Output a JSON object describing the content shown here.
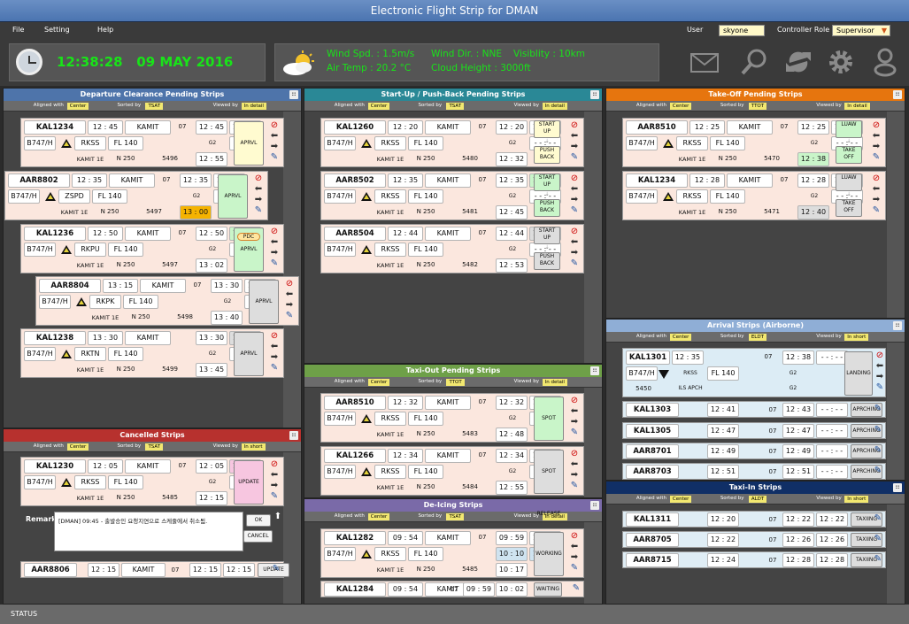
{
  "app": {
    "title": "Electronic Flight Strip for DMAN",
    "status": "STATUS"
  },
  "menu": {
    "file": "File",
    "setting": "Setting",
    "help": "Help",
    "user_label": "User",
    "user_value": "skyone",
    "role_label": "Controller Role",
    "role_value": "Supervisor"
  },
  "clock": {
    "time": "12:38:28",
    "date": "09 MAY 2016"
  },
  "weather": {
    "wind_speed": "Wind Spd. : 1.5m/s",
    "wind_dir": "Wind Dir. : NNE",
    "visibility": "Visiblity : 10km",
    "air_temp": "Air Temp : 20.2 °C",
    "cloud": "Cloud Height : 3000ft"
  },
  "icons": [
    "mail-icon",
    "search-icon",
    "refresh-icon",
    "gear-icon",
    "user-icon"
  ],
  "colors": {
    "departure": "#4e74aa",
    "startup": "#1f7f8f",
    "takeoff": "#e6750e",
    "arrival": "#8faed6",
    "taxiin": "#102f66",
    "cancelled": "#b7312e",
    "taxiout": "#6ea048",
    "deicing": "#7a6aa8",
    "time_green": "#19e319"
  },
  "panels": {
    "departure": {
      "title": "Departure Clearance Pending Strips",
      "aligned": "Aligned with",
      "aligned_val": "Center",
      "sorted": "Sorted by",
      "sorted_val": "TSAT",
      "viewed": "Viewed by",
      "viewed_val": "In detail"
    },
    "startup": {
      "title": "Start-Up / Push-Back Pending Strips",
      "aligned": "Aligned with",
      "aligned_val": "Center",
      "sorted": "Sorted by",
      "sorted_val": "TSAT",
      "viewed": "Viewed by",
      "viewed_val": "In detail"
    },
    "takeoff": {
      "title": "Take-Off Pending Strips",
      "aligned": "Aligned with",
      "aligned_val": "Center",
      "sorted": "Sorted by",
      "sorted_val": "TTOT",
      "viewed": "Viewed by",
      "viewed_val": "In detail"
    },
    "arrival": {
      "title": "Arrival  Strips (Airborne)",
      "aligned": "Aligned with",
      "aligned_val": "Center",
      "sorted": "Sorted by",
      "sorted_val": "ELDT",
      "viewed": "Viewed by",
      "viewed_val": "In short"
    },
    "taxiin": {
      "title": "Taxi-In Strips",
      "aligned": "Aligned with",
      "aligned_val": "Center",
      "sorted": "Sorted by",
      "sorted_val": "ALDT",
      "viewed": "Viewed by",
      "viewed_val": "In short"
    },
    "cancelled": {
      "title": "Cancelled Strips",
      "aligned": "Aligned with",
      "aligned_val": "Center",
      "sorted": "Sorted by",
      "sorted_val": "TSAT",
      "viewed": "Viewed by",
      "viewed_val": "In short"
    },
    "taxiout": {
      "title": "Taxi-Out Pending Strips",
      "aligned": "Aligned with",
      "aligned_val": "Center",
      "sorted": "Sorted by",
      "sorted_val": "TTOT",
      "viewed": "Viewed by",
      "viewed_val": "In detail"
    },
    "deicing": {
      "title": "De-Icing Strips",
      "aligned": "Aligned with",
      "aligned_val": "Center",
      "sorted": "Sorted by",
      "sorted_val": "TSAT",
      "viewed": "Viewed by",
      "viewed_val": "In detail"
    }
  },
  "strips": {
    "dep1": {
      "cs": "KAL1234",
      "t1": "12 : 45",
      "fix": "KAMIT",
      "rw": "07",
      "t2": "12 : 45",
      "t3": "12 : 45",
      "ac": "B747/H",
      "ap": "RKSS",
      "fl": "FL 140",
      "gate": "G2",
      "t4": "- - : - -",
      "sid": "KAMIT 1E",
      "n": "N 250",
      "sq": "5496",
      "t5": "12 : 55",
      "btn": "APRVL"
    },
    "dep2": {
      "cs": "AAR8802",
      "t1": "12 : 35",
      "fix": "KAMIT",
      "rw": "07",
      "t2": "12 : 35",
      "t3": "12 : 50",
      "ac": "B747/H",
      "ap": "ZSPD",
      "fl": "FL 140",
      "gate": "G2",
      "t4": "- - : - -",
      "sid": "KAMIT 1E",
      "n": "N 250",
      "sq": "5497",
      "t5": "13 : 00",
      "btn": "APRVL"
    },
    "dep3": {
      "cs": "KAL1236",
      "t1": "12 : 50",
      "fix": "KAMIT",
      "rw": "07",
      "t2": "12 : 50",
      "t3": "12 : 52",
      "ac": "B747/H",
      "ap": "RKPU",
      "fl": "FL 140",
      "gate": "G2",
      "t4": "- - : - -",
      "sid": "KAMIT 1E",
      "n": "N 250",
      "sq": "5497",
      "t5": "13 : 02",
      "btn": "APRVL",
      "pdc": "PDC"
    },
    "dep4": {
      "cs": "AAR8804",
      "t1": "13 : 15",
      "fix": "KAMIT",
      "rw": "07",
      "t2": "13 : 30",
      "t3": "13 : 30",
      "ac": "B747/H",
      "ap": "RKPK",
      "fl": "FL 140",
      "gate": "G2",
      "t4": "- - : - -",
      "sid": "KAMIT 1E",
      "n": "N 250",
      "sq": "5498",
      "t5": "13 : 40",
      "btn": "APRVL"
    },
    "dep5": {
      "cs": "KAL1238",
      "t1": "13 : 30",
      "fix": "KAMIT",
      "rw": "",
      "t2": "13 : 30",
      "t3": "13 : 35",
      "ac": "B747/H",
      "ap": "RKTN",
      "fl": "FL 140",
      "gate": "G2",
      "t4": "- - : - -",
      "sid": "KAMIT 1E",
      "n": "N 250",
      "sq": "5499",
      "t5": "13 : 45",
      "btn": "APRVL"
    },
    "su1": {
      "cs": "KAL1260",
      "t1": "12 : 20",
      "fix": "KAMIT",
      "rw": "07",
      "t2": "12 : 20",
      "t3": "12 : 22",
      "ac": "B747/H",
      "ap": "RKSS",
      "fl": "FL 140",
      "gate": "G2",
      "t4": "- - : - -",
      "sid": "KAMIT 1E",
      "n": "N 250",
      "sq": "5480",
      "t5": "12 : 32",
      "btn1": "START UP",
      "btn2": "PUSH BACK"
    },
    "su2": {
      "cs": "AAR8502",
      "t1": "12 : 35",
      "fix": "KAMIT",
      "rw": "07",
      "t2": "12 : 35",
      "t3": "12 : 35",
      "ac": "B747/H",
      "ap": "RKSS",
      "fl": "FL 140",
      "gate": "G2",
      "t4": "- - : - -",
      "sid": "KAMIT 1E",
      "n": "N 250",
      "sq": "5481",
      "t5": "12 : 45",
      "btn1": "START UP",
      "btn2": "PUSH BACK"
    },
    "su3": {
      "cs": "AAR8504",
      "t1": "12 : 44",
      "fix": "KAMIT",
      "rw": "07",
      "t2": "12 : 44",
      "t3": "12 : 44",
      "ac": "B747/H",
      "ap": "RKSS",
      "fl": "FL 140",
      "gate": "G2",
      "t4": "- - : - -",
      "sid": "KAMIT 1E",
      "n": "N 250",
      "sq": "5482",
      "t5": "12 : 53",
      "btn1": "START UP",
      "btn2": "PUSH BACK"
    },
    "to1": {
      "cs": "AAR8510",
      "t1": "12 : 25",
      "fix": "KAMIT",
      "rw": "07",
      "t2": "12 : 25",
      "t3": "12 : 25",
      "ac": "B747/H",
      "ap": "RKSS",
      "fl": "FL 140",
      "gate": "G2",
      "t4": "- - : - -",
      "sid": "KAMIT 1E",
      "n": "N 250",
      "sq": "5470",
      "t5": "12 : 38",
      "btn1": "LUAW",
      "btn2": "TAKE OFF"
    },
    "to2": {
      "cs": "KAL1234",
      "t1": "12 : 28",
      "fix": "KAMIT",
      "rw": "07",
      "t2": "12 : 28",
      "t3": "12 : 28",
      "ac": "B747/H",
      "ap": "RKSS",
      "fl": "FL 140",
      "gate": "G2",
      "t4": "- - : - -",
      "sid": "KAMIT 1E",
      "n": "N 250",
      "sq": "5471",
      "t5": "12 : 40",
      "btn1": "LUAW",
      "btn2": "TAKE OFF"
    },
    "tx1": {
      "cs": "AAR8510",
      "t1": "12 : 32",
      "fix": "KAMIT",
      "rw": "07",
      "t2": "12 : 32",
      "t3": "12 : 32",
      "ac": "B747/H",
      "ap": "RKSS",
      "fl": "FL 140",
      "gate": "G2",
      "t4": "- - : - -",
      "sid": "KAMIT 1E",
      "n": "N 250",
      "sq": "5483",
      "t5": "12 : 48",
      "btn": "SPOT RELEASE"
    },
    "tx2": {
      "cs": "KAL1266",
      "t1": "12 : 34",
      "fix": "KAMIT",
      "rw": "07",
      "t2": "12 : 34",
      "t3": "12 : 34",
      "ac": "B747/H",
      "ap": "RKSS",
      "fl": "FL 140",
      "gate": "G2",
      "t4": "- - : - -",
      "sid": "KAMIT 1E",
      "n": "N 250",
      "sq": "5484",
      "t5": "12 : 55",
      "btn": "SPOT RELEASE"
    },
    "di1": {
      "cs": "KAL1282",
      "t1": "09 : 54",
      "fix": "KAMIT",
      "rw": "07",
      "t2": "09 : 59",
      "t3": "10 : 02",
      "ac": "B747/H",
      "ap": "RKSS",
      "fl": "FL 140",
      "t4": "10 : 10",
      "t4b": "10 : 25",
      "sid": "KAMIT 1E",
      "n": "N 250",
      "sq": "5485",
      "t5": "10 : 17",
      "btn": "WORKING"
    },
    "di2": {
      "cs": "KAL1284",
      "t1": "09 : 54",
      "fix": "KAMIT",
      "rw": "07",
      "t2": "09 : 59",
      "t3": "10 : 02",
      "btn": "WAITING"
    },
    "cx1": {
      "cs": "KAL1230",
      "t1": "12 : 05",
      "fix": "KAMIT",
      "rw": "07",
      "t2": "12 : 05",
      "t3": "13 : 55",
      "ac": "B747/H",
      "ap": "RKSS",
      "fl": "FL 140",
      "gate": "G2",
      "t4": "- - : - -",
      "sid": "KAMIT 1E",
      "n": "N 250",
      "sq": "5485",
      "t5": "12 : 15",
      "btn": "UPDATE"
    },
    "cx2": {
      "cs": "AAR8806",
      "t1": "12 : 15",
      "fix": "KAMIT",
      "rw": "07",
      "t2": "12 : 15",
      "t3": "12 : 15",
      "btn": "UPDATE"
    },
    "ar1": {
      "cs": "KAL1301",
      "t1": "12 : 35",
      "rw": "07",
      "t2": "12 : 38",
      "t3": "- - : - -",
      "ac": "B747/H",
      "ap": "RKSS",
      "fl": "FL 140",
      "gate": "G2",
      "sq": "5450",
      "apch": "ILS APCH",
      "g2b": "G2",
      "btn": "LANDING"
    },
    "ar2": {
      "cs": "KAL1303",
      "t1": "12 : 41",
      "rw": "07",
      "t2": "12 : 43",
      "t3": "- - : - -",
      "btn": "APRCHING"
    },
    "ar3": {
      "cs": "KAL1305",
      "t1": "12 : 47",
      "rw": "07",
      "t2": "12 : 47",
      "t3": "- - : - -",
      "btn": "APRCHING"
    },
    "ar4": {
      "cs": "AAR8701",
      "t1": "12 : 49",
      "rw": "07",
      "t2": "12 : 49",
      "t3": "- - : - -",
      "btn": "APRCHING"
    },
    "ar5": {
      "cs": "AAR8703",
      "t1": "12 : 51",
      "rw": "07",
      "t2": "12 : 51",
      "t3": "- - : - -",
      "btn": "APRCHING"
    },
    "ti1": {
      "cs": "KAL1311",
      "t1": "12 : 20",
      "rw": "07",
      "t2": "12 : 22",
      "t3": "12 : 22",
      "btn": "TAXIING"
    },
    "ti2": {
      "cs": "AAR8705",
      "t1": "12 : 22",
      "rw": "07",
      "t2": "12 : 26",
      "t3": "12 : 26",
      "btn": "TAXIING"
    },
    "ti3": {
      "cs": "AAR8715",
      "t1": "12 : 24",
      "rw": "07",
      "t2": "12 : 28",
      "t3": "12 : 28",
      "btn": "TAXIING"
    }
  },
  "remark": {
    "label": "Remark",
    "text": "[DMAN] 09:45 - 출발승인 요청지연으로 스케줄에서 취소됨.",
    "ok": "OK",
    "cancel": "CANCEL"
  }
}
